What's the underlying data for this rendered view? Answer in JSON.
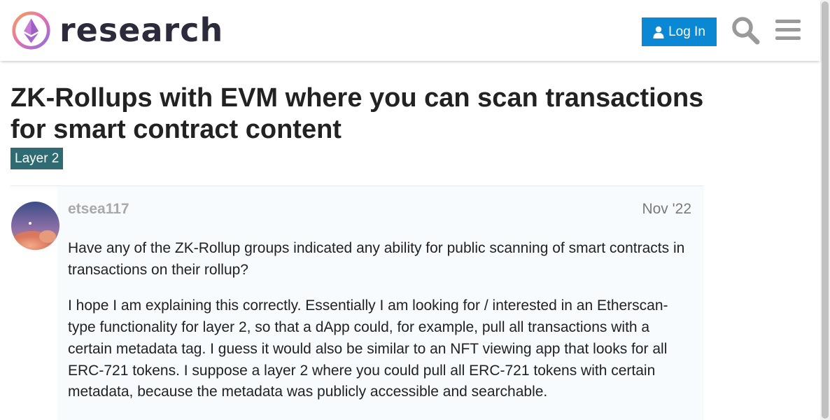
{
  "header": {
    "logo_text": "research",
    "login_label": "Log In",
    "search_icon": "search-icon",
    "menu_icon": "hamburger-menu-icon"
  },
  "topic": {
    "title": "ZK-Rollups with EVM where you can scan transactions for smart contract content",
    "category": "Layer 2",
    "category_color": "#2f6b72"
  },
  "post": {
    "username": "etsea117",
    "date": "Nov '22",
    "paragraphs": [
      "Have any of the ZK-Rollup groups indicated any ability for public scanning of smart contracts in transactions on their rollup?",
      "I hope I am explaining this correctly. Essentially I am looking for / interested in an Etherscan-type functionality for layer 2, so that a dApp could, for example, pull all transactions with a certain metadata tag. I guess it would also be similar to an NFT viewing app that looks for all ERC-721 tokens. I suppose a layer 2 where you could pull all ERC-721 tokens with certain metadata, because the metadata was publicly accessible and searchable."
    ]
  },
  "colors": {
    "accent": "#0a88d4",
    "title_text": "#222222",
    "post_background": "#f7fbfe"
  }
}
